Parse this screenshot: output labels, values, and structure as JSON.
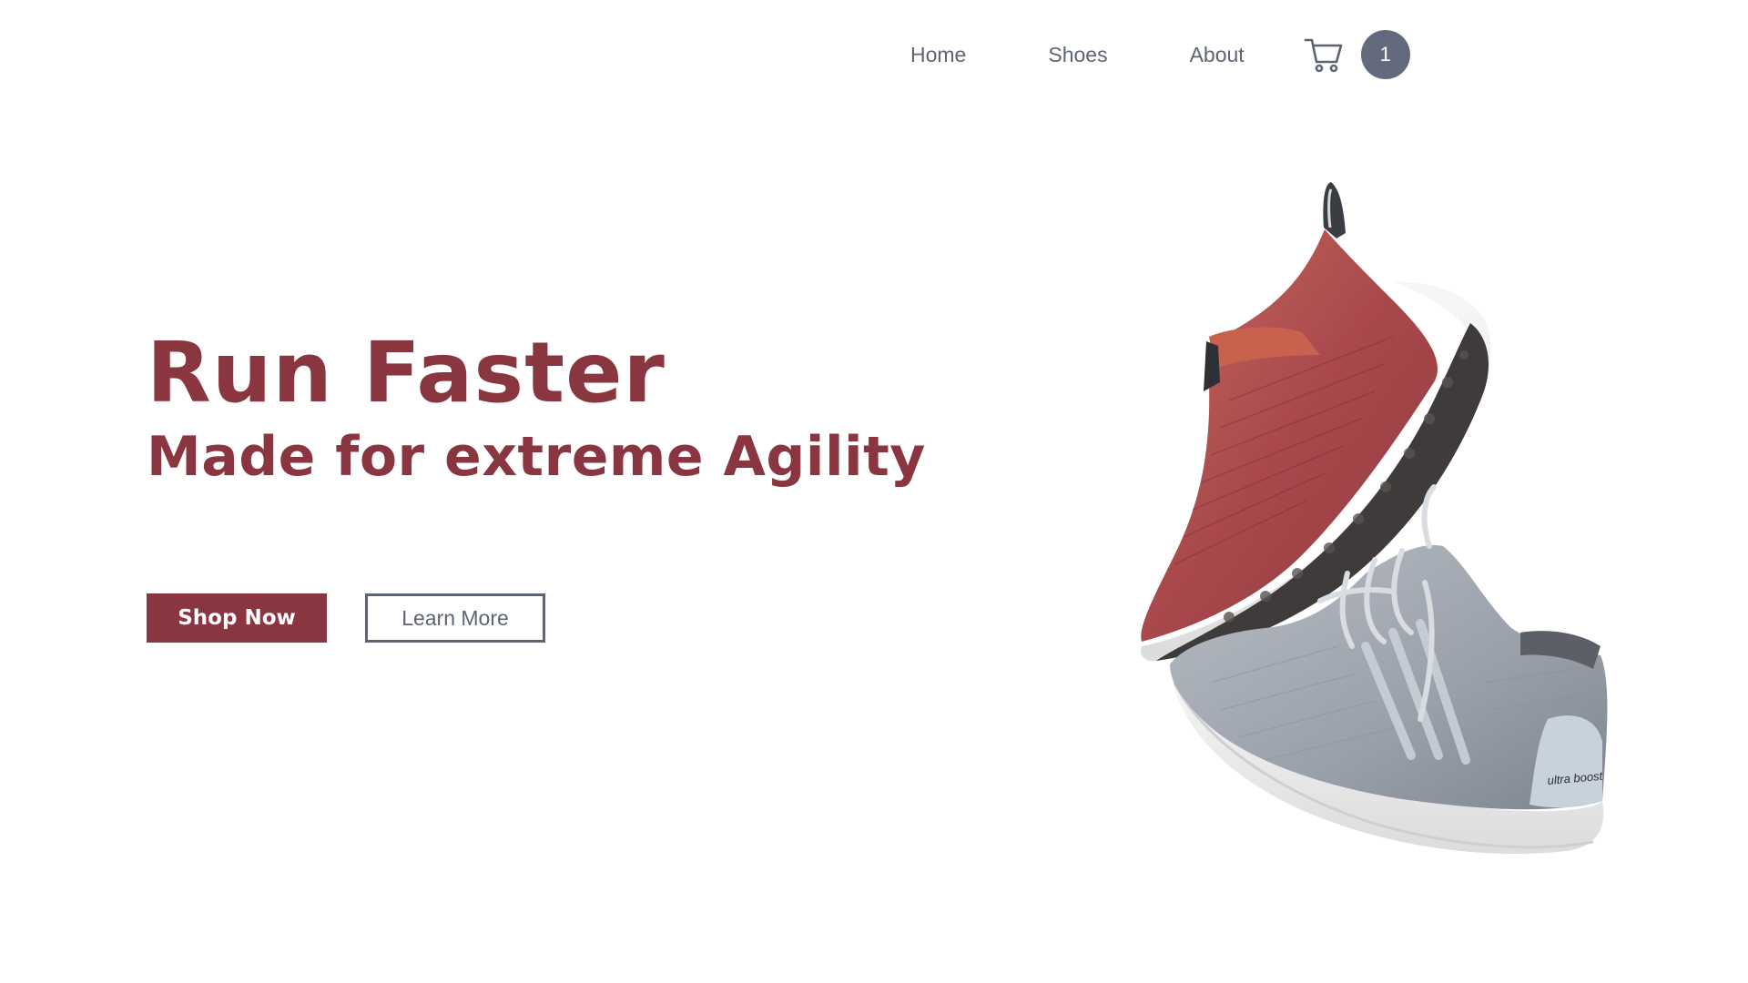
{
  "nav": {
    "links": [
      "Home",
      "Shoes",
      "About"
    ],
    "cart_count": "1"
  },
  "hero": {
    "title": "Run Faster",
    "subtitle": "Made for extreme Agility",
    "primary_cta": "Shop Now",
    "secondary_cta": "Learn More"
  },
  "product_image": {
    "brand_text": "ultra boost"
  },
  "icons": {
    "cart": "cart-icon"
  },
  "colors": {
    "brand": "#8a3640",
    "text_muted": "#5e6472",
    "badge": "#646a7d"
  }
}
